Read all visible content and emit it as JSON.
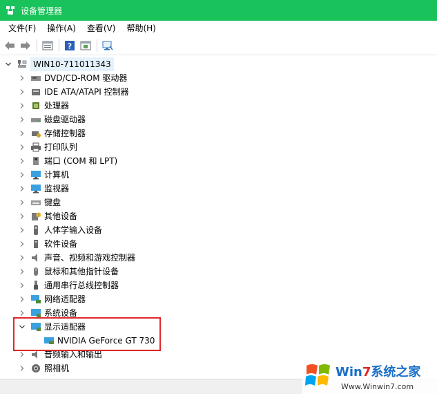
{
  "window": {
    "title": "设备管理器",
    "accent": "#19c25a"
  },
  "menu": [
    "文件(F)",
    "操作(A)",
    "查看(V)",
    "帮助(H)"
  ],
  "toolbar": [
    "back-icon",
    "forward-icon",
    "properties-icon",
    "help-icon",
    "update-icon",
    "scan-hardware-icon"
  ],
  "tree": {
    "root": "WIN10-711011343",
    "items": [
      "DVD/CD-ROM 驱动器",
      "IDE ATA/ATAPI 控制器",
      "处理器",
      "磁盘驱动器",
      "存储控制器",
      "打印队列",
      "端口 (COM 和 LPT)",
      "计算机",
      "监视器",
      "键盘",
      "其他设备",
      "人体学输入设备",
      "软件设备",
      "声音、视频和游戏控制器",
      "鼠标和其他指针设备",
      "通用串行总线控制器",
      "网络适配器",
      "系统设备",
      "显示适配器",
      "音频输入和输出",
      "照相机"
    ],
    "expanded_child": "NVIDIA GeForce GT 730"
  },
  "highlight_color": "#e0262a",
  "watermark": {
    "brand": "Win7系统之家",
    "url": "Www.Winwin7.com"
  }
}
